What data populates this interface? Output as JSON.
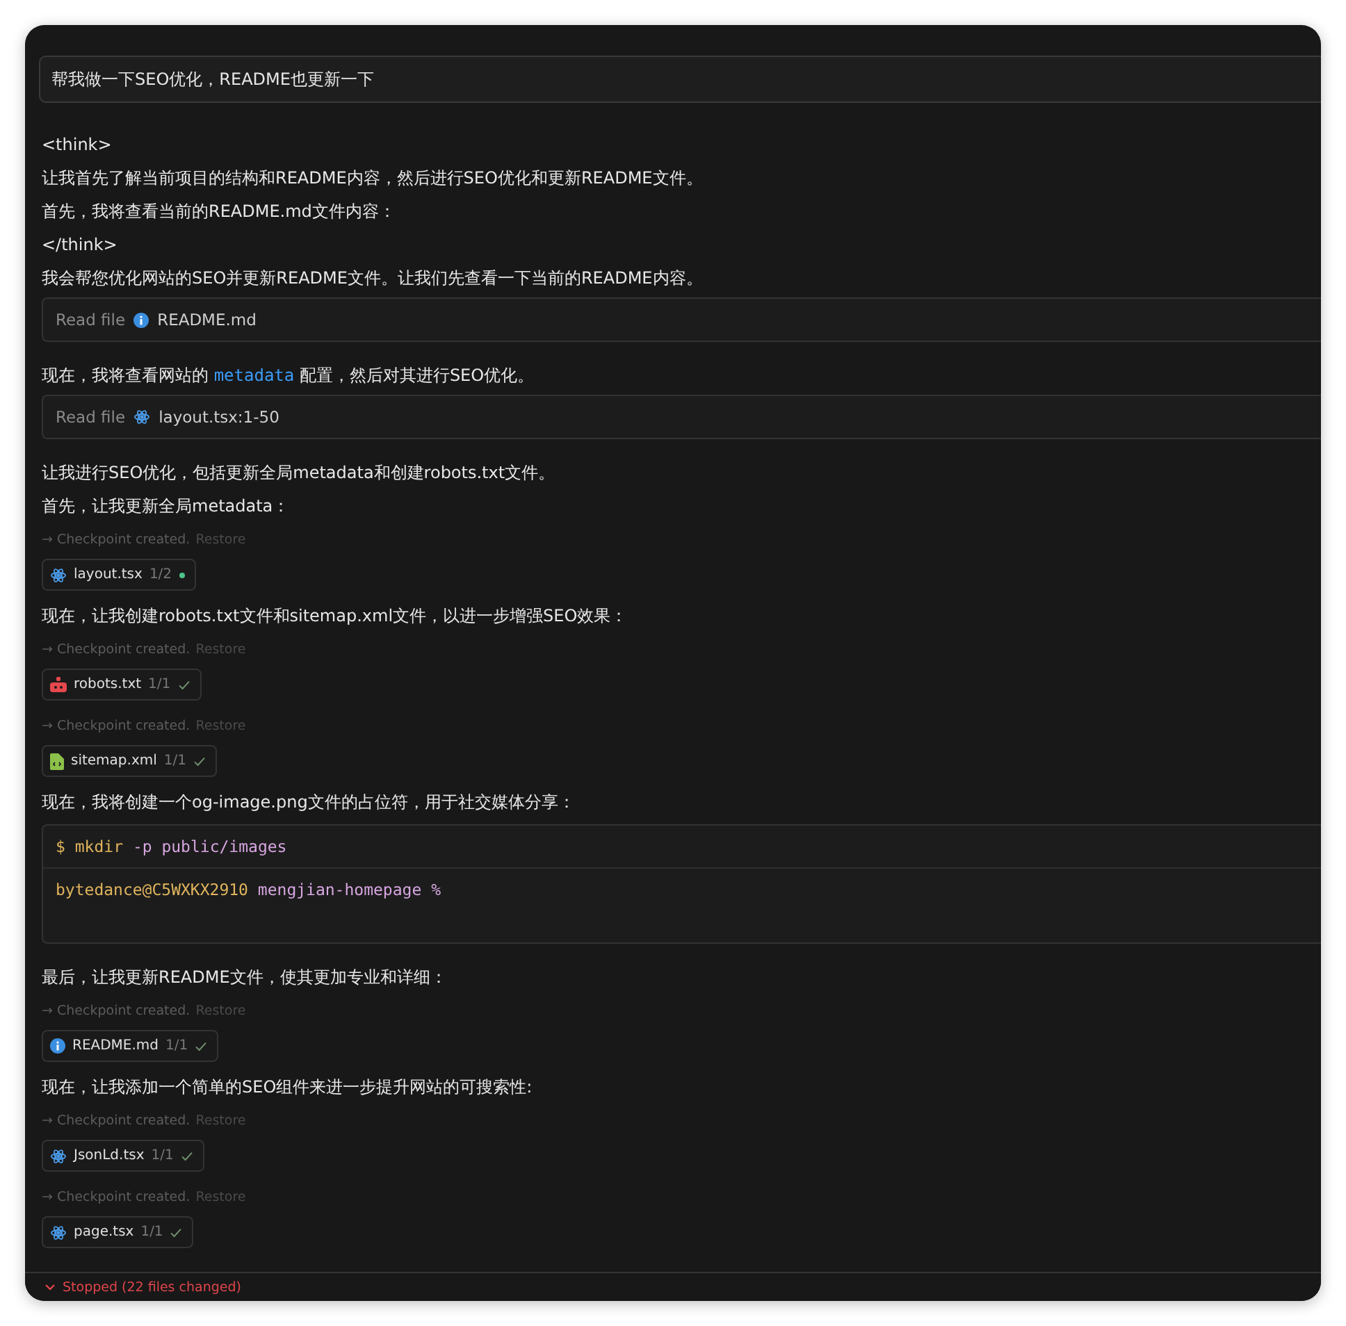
{
  "prompt": "帮我做一下SEO优化，README也更新一下",
  "messages": [
    {
      "kind": "text",
      "parts": [
        {
          "text": "<think>"
        }
      ]
    },
    {
      "kind": "text",
      "parts": [
        {
          "text": "让我首先了解当前项目的结构和README内容，然后进行SEO优化和更新README文件。"
        }
      ]
    },
    {
      "kind": "text",
      "parts": [
        {
          "text": "首先，我将查看当前的README.md文件内容："
        }
      ]
    },
    {
      "kind": "text",
      "parts": [
        {
          "text": "</think>"
        }
      ]
    },
    {
      "kind": "text",
      "parts": [
        {
          "text": "我会帮您优化网站的SEO并更新README文件。让我们先查看一下当前的README内容。"
        }
      ]
    },
    {
      "kind": "tool",
      "label": "Read file",
      "icon": {
        "kind": "info"
      },
      "file": "README.md"
    },
    {
      "kind": "text",
      "parts": [
        {
          "text": "现在，我将查看网站的 "
        },
        {
          "text": "metadata",
          "code": true
        },
        {
          "text": " 配置，然后对其进行SEO优化。"
        }
      ]
    },
    {
      "kind": "tool",
      "label": "Read file",
      "icon": {
        "kind": "react"
      },
      "file": "layout.tsx:1-50"
    },
    {
      "kind": "text",
      "parts": [
        {
          "text": "让我进行SEO优化，包括更新全局metadata和创建robots.txt文件。"
        }
      ]
    },
    {
      "kind": "text",
      "parts": [
        {
          "text": "首先，让我更新全局metadata："
        }
      ]
    },
    {
      "kind": "checkpoint",
      "arrow": "→",
      "text": "Checkpoint created.",
      "action": "Restore"
    },
    {
      "kind": "file",
      "icon": {
        "kind": "react"
      },
      "name": "layout.tsx",
      "count": "1/2",
      "done": false
    },
    {
      "kind": "text",
      "parts": [
        {
          "text": "现在，让我创建robots.txt文件和sitemap.xml文件，以进一步增强SEO效果："
        }
      ]
    },
    {
      "kind": "checkpoint",
      "arrow": "→",
      "text": "Checkpoint created.",
      "action": "Restore"
    },
    {
      "kind": "file",
      "icon": {
        "kind": "robot"
      },
      "name": "robots.txt",
      "count": "1/1",
      "done": true
    },
    {
      "kind": "checkpoint",
      "arrow": "→",
      "text": "Checkpoint created.",
      "action": "Restore"
    },
    {
      "kind": "file",
      "icon": {
        "kind": "xml"
      },
      "name": "sitemap.xml",
      "count": "1/1",
      "done": true
    },
    {
      "kind": "text",
      "parts": [
        {
          "text": "现在，我将创建一个og-image.png文件的占位符，用于社交媒体分享："
        }
      ]
    },
    {
      "kind": "terminal",
      "symbol": "$",
      "command": "mkdir -p public/images",
      "user": "bytedance@C5WXKX2910",
      "dir": "mengjian-homepage",
      "suffix": "%"
    },
    {
      "kind": "text",
      "parts": [
        {
          "text": "最后，让我更新README文件，使其更加专业和详细："
        }
      ]
    },
    {
      "kind": "checkpoint",
      "arrow": "→",
      "text": "Checkpoint created.",
      "action": "Restore"
    },
    {
      "kind": "file",
      "icon": {
        "kind": "info"
      },
      "name": "README.md",
      "count": "1/1",
      "done": true
    },
    {
      "kind": "text",
      "parts": [
        {
          "text": "现在，让我添加一个简单的SEO组件来进一步提升网站的可搜索性:"
        }
      ]
    },
    {
      "kind": "checkpoint",
      "arrow": "→",
      "text": "Checkpoint created.",
      "action": "Restore"
    },
    {
      "kind": "file",
      "icon": {
        "kind": "react"
      },
      "name": "JsonLd.tsx",
      "count": "1/1",
      "done": true
    },
    {
      "kind": "checkpoint",
      "arrow": "→",
      "text": "Checkpoint created.",
      "action": "Restore"
    },
    {
      "kind": "file",
      "icon": {
        "kind": "react"
      },
      "name": "page.tsx",
      "count": "1/1",
      "done": true
    }
  ],
  "status": {
    "text": "Stopped (22 files changed)"
  }
}
